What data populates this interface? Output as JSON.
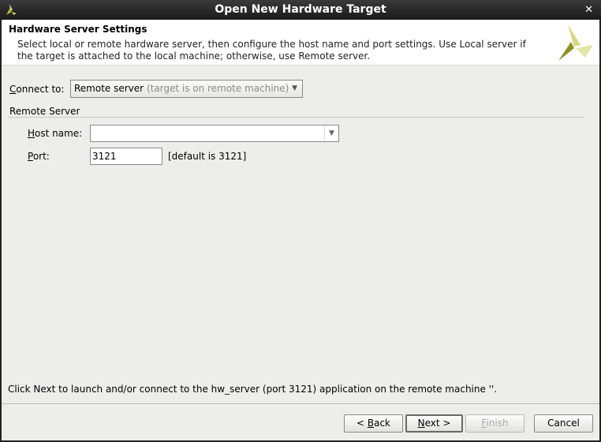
{
  "window": {
    "title": "Open New Hardware Target",
    "close_icon": "close-icon",
    "app_icon": "xilinx-logo-icon"
  },
  "header": {
    "title": "Hardware Server Settings",
    "description": "Select local or remote hardware server, then configure the host name and port settings. Use Local server if the target is attached to the local machine; otherwise, use Remote server."
  },
  "connect": {
    "label_m": "C",
    "label_rest": "onnect to:",
    "value": "Remote server",
    "hint": "(target is on remote machine)"
  },
  "remote": {
    "section": "Remote Server",
    "host_label_m": "H",
    "host_label_rest": "ost name:",
    "host_value": "",
    "port_label_m": "P",
    "port_label_rest": "ort:",
    "port_value": "3121",
    "port_default": "[default is 3121]"
  },
  "status": "Click Next to launch and/or connect to the hw_server (port 3121) application on the remote machine ''.",
  "buttons": {
    "back_pre": "< ",
    "back_m": "B",
    "back_rest": "ack",
    "next_m": "N",
    "next_rest": "ext >",
    "finish_m": "F",
    "finish_rest": "inish",
    "cancel": "Cancel"
  },
  "colors": {
    "logo_light": "#d6d97a",
    "logo_dark": "#8f9120"
  }
}
